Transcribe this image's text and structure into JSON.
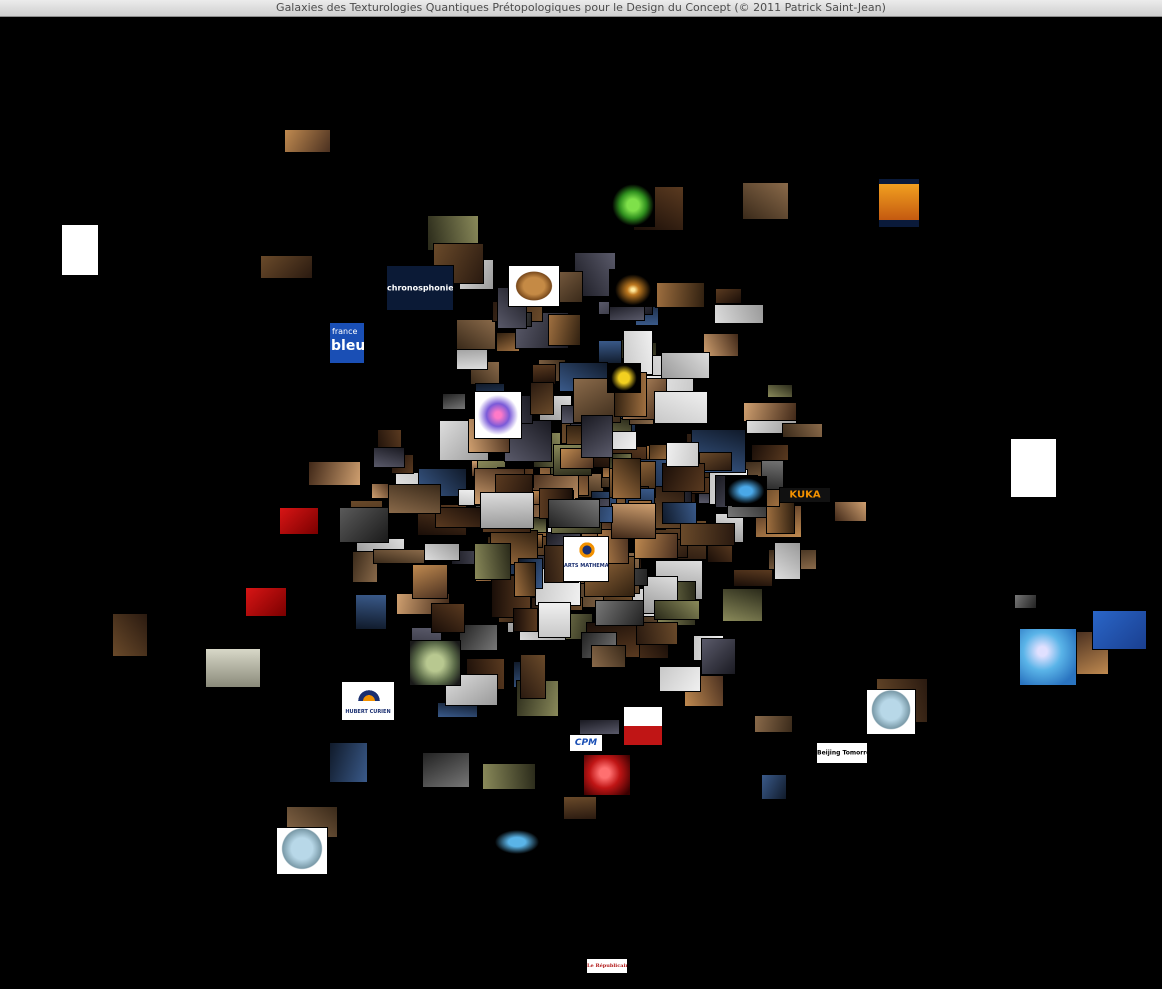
{
  "window": {
    "title": "Galaxies des Texturologies Quantiques Prétopologiques pour le Design du Concept (© 2011 Patrick Saint-Jean)"
  },
  "labels": {
    "chronosphonie": "chronosphonie",
    "france": "france",
    "bleu": "bleu",
    "kuka": "KUKA",
    "hubert_curien": "HUBERT CURIEN",
    "beijing": "Beijing Tomorrow",
    "republicain": "Le Républicain",
    "arts_maths": "ARTS MATHÉMATIQUES",
    "cpm": "CPM"
  },
  "colors": {
    "background": "#000000",
    "titlebar_text": "#4c4c4c",
    "france_bleu": "#1a4fb5",
    "kuka_orange": "#f29100"
  }
}
